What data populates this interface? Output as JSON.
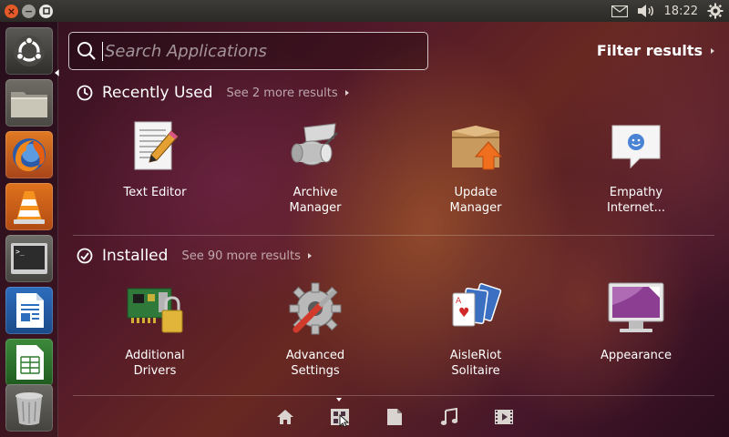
{
  "panel": {
    "clock": "18:22"
  },
  "launcher": {
    "items": [
      {
        "name": "dash-home",
        "icon": "ubuntu-logo-icon"
      },
      {
        "name": "files",
        "icon": "folder-icon"
      },
      {
        "name": "firefox",
        "icon": "firefox-icon"
      },
      {
        "name": "vlc",
        "icon": "vlc-cone-icon"
      },
      {
        "name": "terminal",
        "icon": "terminal-icon"
      },
      {
        "name": "writer",
        "icon": "document-icon"
      },
      {
        "name": "calc",
        "icon": "spreadsheet-icon"
      },
      {
        "name": "trash",
        "icon": "trash-icon"
      }
    ]
  },
  "dash": {
    "search_placeholder": "Search Applications",
    "filter_label": "Filter results",
    "recent": {
      "title": "Recently Used",
      "more": "See 2 more results",
      "apps": [
        {
          "label": "Text Editor",
          "icon": "text-editor-icon"
        },
        {
          "label": "Archive\nManager",
          "icon": "archive-manager-icon"
        },
        {
          "label": "Update\nManager",
          "icon": "update-manager-icon"
        },
        {
          "label": "Empathy\nInternet...",
          "icon": "empathy-icon"
        }
      ]
    },
    "installed": {
      "title": "Installed",
      "more": "See 90 more results",
      "apps": [
        {
          "label": "Additional\nDrivers",
          "icon": "additional-drivers-icon"
        },
        {
          "label": "Advanced\nSettings",
          "icon": "advanced-settings-icon"
        },
        {
          "label": "AisleRiot\nSolitaire",
          "icon": "solitaire-icon"
        },
        {
          "label": "Appearance",
          "icon": "appearance-icon"
        }
      ]
    },
    "lenses": [
      "home-icon",
      "applications-icon",
      "files-icon",
      "music-icon",
      "video-icon"
    ],
    "active_lens": "applications-icon"
  },
  "colors": {
    "panel": "#3c3b37",
    "close_button": "#e45a28",
    "firefox_orange": "#e8701a",
    "text_white": "#ffffff"
  }
}
